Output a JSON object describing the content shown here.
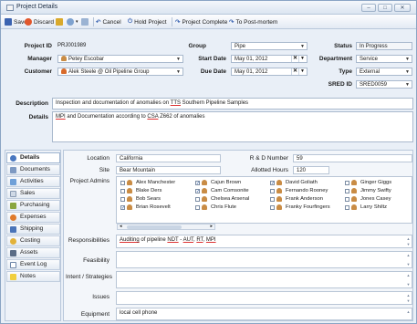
{
  "window": {
    "title": "Project Details",
    "buttons": [
      "–",
      "□",
      "✕"
    ]
  },
  "toolbar": {
    "save": "Save",
    "discard": "Discard",
    "cancel": "Cancel",
    "hold": "Hold Project",
    "complete": "Project Complete",
    "postmortem": "To Post-mortem"
  },
  "header": {
    "project_id": {
      "label": "Project ID",
      "value": "PRJ001989"
    },
    "group": {
      "label": "Group",
      "value": "Pipe"
    },
    "status": {
      "label": "Status",
      "value": "In Progress"
    },
    "manager": {
      "label": "Manager",
      "value": "Petey Escobar"
    },
    "start_date": {
      "label": "Start Date",
      "value": "May 01, 2012"
    },
    "department": {
      "label": "Department",
      "value": "Service"
    },
    "customer": {
      "label": "Customer",
      "value": "Alek Steele @ Oil Pipeline Group"
    },
    "due_date": {
      "label": "Due Date",
      "value": "May 01, 2012"
    },
    "type": {
      "label": "Type",
      "value": "External"
    },
    "sred_id": {
      "label": "SRED ID",
      "value": "SRED0059"
    }
  },
  "description": {
    "label": "Description",
    "pre": "Inspection and documentation of anomalies on ",
    "link": "TTS",
    "post": " Southern Pipeline Samples"
  },
  "details": {
    "label": "Details",
    "t1": "MPI",
    "t2": " and Documentation according to ",
    "t3": "CSA",
    "t4": " Z662 of anomalies"
  },
  "nav": {
    "items": [
      "Details",
      "Documents",
      "Activities",
      "Sales",
      "Purchasing",
      "Expenses",
      "Shipping",
      "Costing",
      "Assets",
      "Event Log",
      "Notes"
    ]
  },
  "detail": {
    "location": {
      "label": "Location",
      "value": "California"
    },
    "rd_number": {
      "label": "R & D Number",
      "value": "59"
    },
    "site": {
      "label": "Site",
      "value": "Bear Mountain"
    },
    "allotted": {
      "label": "Allotted Hours",
      "value": "120"
    },
    "admins_label": "Project Admins",
    "admins": [
      {
        "name": "Alex Manchester",
        "checked": false
      },
      {
        "name": "Blake Ders",
        "checked": false
      },
      {
        "name": "Bob Sears",
        "checked": false
      },
      {
        "name": "Brian Rosevelt",
        "checked": true
      },
      {
        "name": "Cajun Brown",
        "checked": true
      },
      {
        "name": "Cam Comsonite",
        "checked": true
      },
      {
        "name": "Chelsea Arsenal",
        "checked": false
      },
      {
        "name": "Chris Flute",
        "checked": false
      },
      {
        "name": "David Goliath",
        "checked": true
      },
      {
        "name": "Fernando Rooney",
        "checked": false
      },
      {
        "name": "Frank Anderson",
        "checked": false
      },
      {
        "name": "Franky Fourfingers",
        "checked": false
      },
      {
        "name": "Ginger Giggs",
        "checked": false
      },
      {
        "name": "Jimmy Swifty",
        "checked": false
      },
      {
        "name": "Jones Casey",
        "checked": false
      },
      {
        "name": "Larry Shiltz",
        "checked": false
      }
    ],
    "responsibilities": {
      "label": "Responsibilities",
      "v1": "Auditing",
      "v2": " of pipeline ",
      "v3": "NDT",
      "v4": " - ",
      "v5": "AUT",
      "v6": ", ",
      "v7": "RT",
      "v8": ", ",
      "v9": "MPI"
    },
    "feasibility": {
      "label": "Feasibility",
      "value": ""
    },
    "intent": {
      "label": "Intent / Strategies",
      "value": ""
    },
    "issues": {
      "label": "Issues",
      "value": ""
    },
    "equipment": {
      "label": "Equipment",
      "value": "local cell phone"
    }
  }
}
